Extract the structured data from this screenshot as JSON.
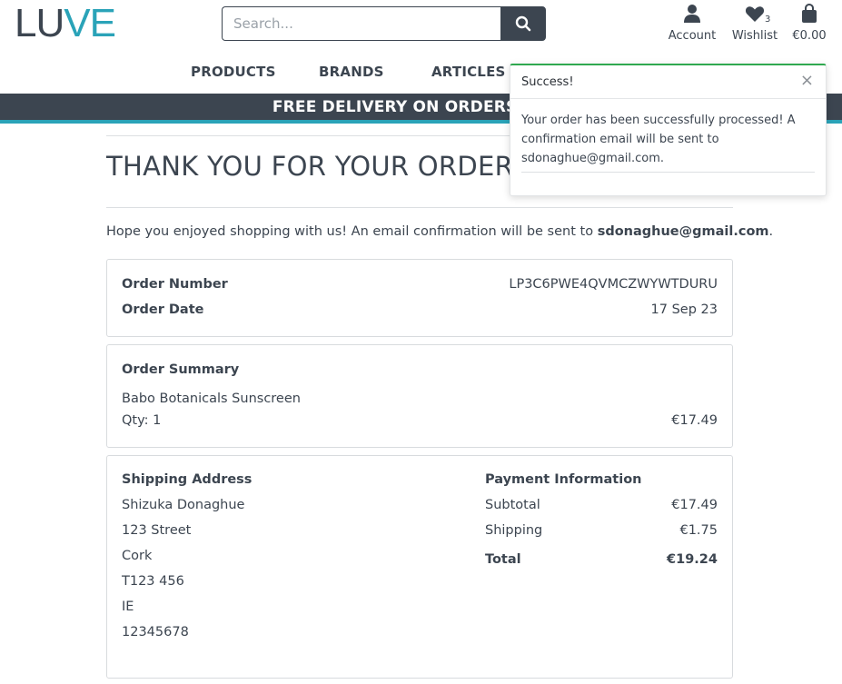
{
  "header": {
    "logo": {
      "part1": "LU",
      "part2": "VE"
    },
    "search": {
      "placeholder": "Search..."
    },
    "account_label": "Account",
    "wishlist_label": "Wishlist",
    "wishlist_count": "3",
    "bag_total": "€0.00"
  },
  "nav": {
    "items": [
      "PRODUCTS",
      "BRANDS",
      "ARTICLES"
    ]
  },
  "banner": {
    "text": "FREE DELIVERY ON ORDERS OV"
  },
  "page": {
    "title": "THANK YOU FOR YOUR ORDER!",
    "intro_prefix": "Hope you enjoyed shopping with us! An email confirmation will be sent to ",
    "intro_email": "sdonaghue@gmail.com",
    "intro_suffix": "."
  },
  "order": {
    "number_label": "Order Number",
    "number": "LP3C6PWE4QVMCZWYWTDURU",
    "date_label": "Order Date",
    "date": "17 Sep 23"
  },
  "summary": {
    "heading": "Order Summary",
    "item_name": "Babo Botanicals Sunscreen",
    "qty_text": "Qty: 1",
    "item_price": "€17.49"
  },
  "shipping": {
    "heading": "Shipping Address",
    "lines": [
      "Shizuka Donaghue",
      "123 Street",
      "Cork",
      "T123 456",
      "IE",
      "12345678"
    ]
  },
  "payment": {
    "heading": "Payment Information",
    "subtotal_label": "Subtotal",
    "subtotal": "€17.49",
    "shipping_label": "Shipping",
    "shipping": "€1.75",
    "total_label": "Total",
    "total": "€19.24"
  },
  "toast": {
    "title": "Success!",
    "close": "×",
    "message": "Your order has been successfully processed! A confirmation email will be sent to sdonaghue@gmail.com."
  },
  "colors": {
    "brand_dark": "#3c4550",
    "brand_accent": "#2aa3b8",
    "success": "#2fa84f"
  }
}
